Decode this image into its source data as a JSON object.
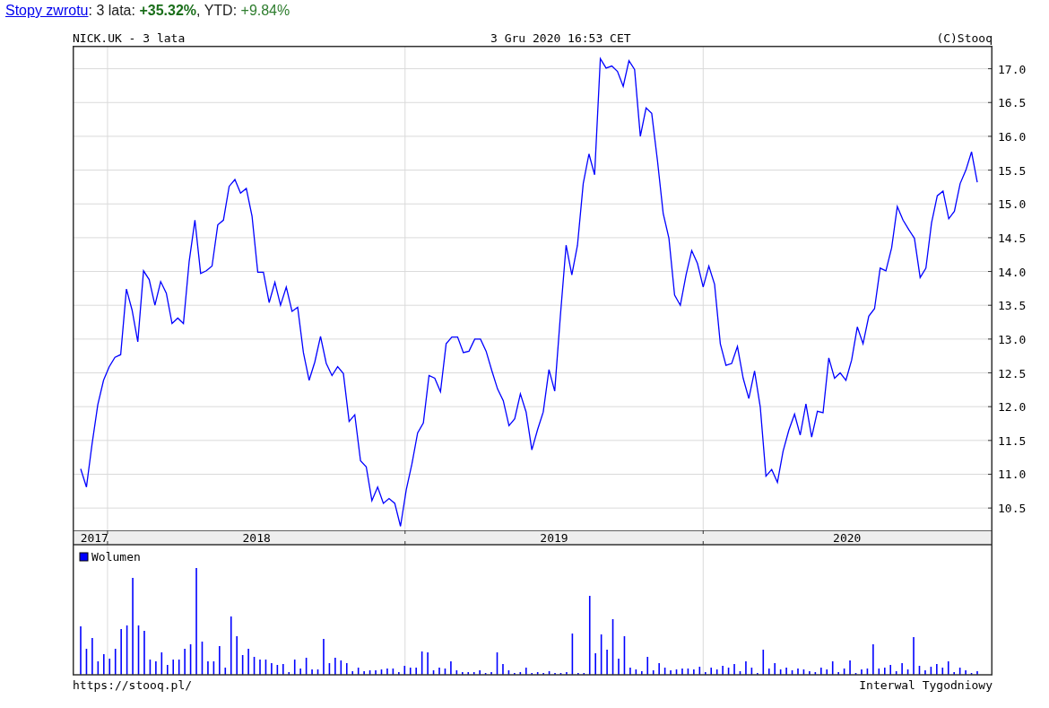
{
  "header": {
    "link": "Stopy zwrotu",
    "period_label": ": 3 lata:",
    "return_3y": "+35.32%",
    "ytd_label": ", YTD:",
    "ytd": "+9.84%"
  },
  "price_chart": {
    "title": "NICK.UK - 3 lata",
    "date": "3 Gru 2020 16:53 CET",
    "copyright": "(C)Stooq",
    "chart_data": {
      "type": "line",
      "grid": true,
      "ylim": [
        10.17,
        17.34
      ],
      "yticks": [
        {
          "value": 10.5,
          "label": "10.5"
        },
        {
          "value": 11,
          "label": "11.0"
        },
        {
          "value": 11.5,
          "label": "11.5"
        },
        {
          "value": 12,
          "label": "12.0"
        },
        {
          "value": 12.5,
          "label": "12.5"
        },
        {
          "value": 13,
          "label": "13.0"
        },
        {
          "value": 13.5,
          "label": "13.5"
        },
        {
          "value": 14,
          "label": "14.0"
        },
        {
          "value": 14.5,
          "label": "14.5"
        },
        {
          "value": 15,
          "label": "15.0"
        },
        {
          "value": 15.5,
          "label": "15.5"
        },
        {
          "value": 16,
          "label": "16.0"
        },
        {
          "value": 16.5,
          "label": "16.5"
        },
        {
          "value": 17,
          "label": "17.0"
        }
      ],
      "series": [
        {
          "color": "#0000ff",
          "values": [
            11.08,
            10.81,
            11.45,
            12.03,
            12.39,
            12.59,
            12.73,
            12.77,
            13.74,
            13.43,
            12.96,
            14.01,
            13.88,
            13.5,
            13.85,
            13.68,
            13.23,
            13.31,
            13.23,
            14.15,
            14.76,
            13.97,
            14.01,
            14.08,
            14.69,
            14.76,
            15.26,
            15.36,
            15.16,
            15.23,
            14.82,
            13.99,
            13.99,
            13.54,
            13.84,
            13.5,
            13.77,
            13.41,
            13.47,
            12.8,
            12.39,
            12.66,
            13.04,
            12.64,
            12.46,
            12.59,
            12.49,
            11.78,
            11.88,
            11.2,
            11.11,
            10.61,
            10.81,
            10.57,
            10.64,
            10.57,
            10.23,
            10.77,
            11.15,
            11.61,
            11.76,
            12.46,
            12.42,
            12.22,
            12.93,
            13.03,
            13.03,
            12.8,
            12.82,
            13.0,
            13.0,
            12.82,
            12.53,
            12.26,
            12.09,
            11.72,
            11.82,
            12.19,
            11.92,
            11.36,
            11.66,
            11.92,
            12.55,
            12.23,
            13.34,
            14.39,
            13.95,
            14.39,
            15.3,
            15.74,
            15.43,
            17.15,
            17.01,
            17.04,
            16.96,
            16.74,
            17.12,
            16.99,
            16.0,
            16.42,
            16.34,
            15.64,
            14.86,
            14.49,
            13.65,
            13.5,
            13.95,
            14.31,
            14.12,
            13.77,
            14.08,
            13.81,
            12.93,
            12.61,
            12.64,
            12.89,
            12.42,
            12.12,
            12.53,
            11.99,
            10.97,
            11.07,
            10.88,
            11.34,
            11.65,
            11.89,
            11.58,
            12.04,
            11.55,
            11.93,
            11.91,
            12.72,
            12.42,
            12.5,
            12.39,
            12.69,
            13.18,
            12.93,
            13.34,
            13.45,
            14.05,
            14.01,
            14.35,
            14.96,
            14.76,
            14.62,
            14.49,
            13.91,
            14.05,
            14.72,
            15.12,
            15.19,
            14.78,
            14.89,
            15.3,
            15.5,
            15.77,
            15.32
          ]
        }
      ]
    }
  },
  "year_axis": {
    "labels": [
      "2017",
      "2018",
      "2019",
      "2020"
    ]
  },
  "volume_chart": {
    "legend": "Wolumen",
    "color": "#0000ff"
  },
  "footer": {
    "source": "https://stooq.pl/",
    "interval": "Interwal Tygodniowy"
  }
}
